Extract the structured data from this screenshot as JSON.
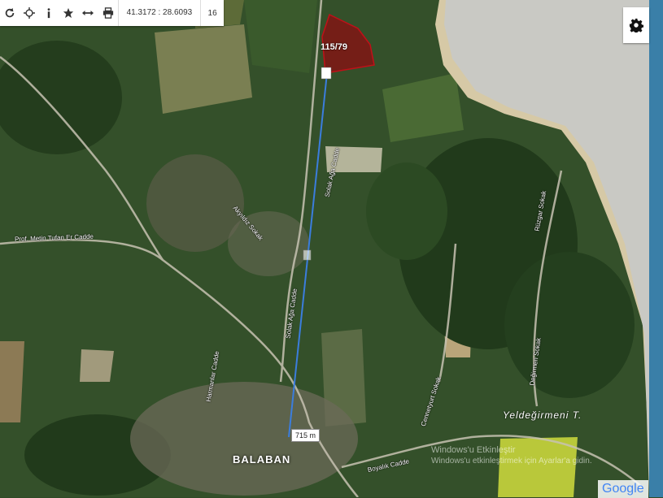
{
  "toolbar": {
    "icons": [
      "refresh-icon",
      "locate-icon",
      "info-icon",
      "star-icon",
      "measure-icon",
      "print-icon"
    ],
    "coordinates": "41.3172 : 28.6093",
    "zoom": "16"
  },
  "parcel": {
    "label": "115/79"
  },
  "measure": {
    "distance": "715 m"
  },
  "streets": [
    {
      "name": "Prof. Metin Tufan Er Cadde"
    },
    {
      "name": "Solak Ağa Cadde"
    },
    {
      "name": "Solak Ağa Cadde"
    },
    {
      "name": "Akyıldız Sokak"
    },
    {
      "name": "Harmanlar Cadde"
    },
    {
      "name": "Rüzgar Sokak"
    },
    {
      "name": "Değirmen Sokak"
    },
    {
      "name": "Cennetyurt Sokak"
    },
    {
      "name": "Boyalık Cadde"
    }
  ],
  "places": {
    "village": "BALABAN",
    "locality": "Yeldeğirmeni T."
  },
  "watermark": {
    "line1": "Windows'u Etkinleştir",
    "line2": "Windows'u etkinleştirmek için Ayarlar'a gidin."
  },
  "attribution": "Google",
  "colors": {
    "parcel_fill": "#8b0d12",
    "measure_line": "#3b7ddd",
    "sea": "#c9c9c4"
  }
}
